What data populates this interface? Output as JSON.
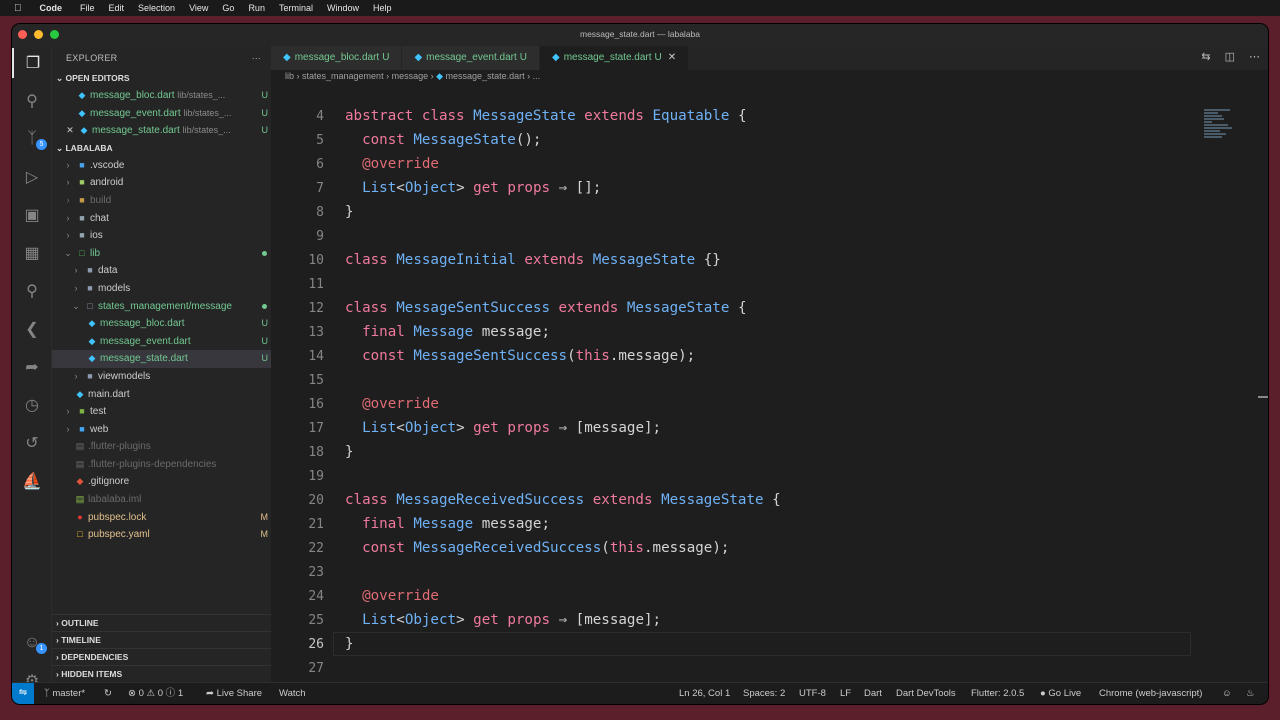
{
  "menubar": {
    "items": [
      "Code",
      "File",
      "Edit",
      "Selection",
      "View",
      "Go",
      "Run",
      "Terminal",
      "Window",
      "Help"
    ]
  },
  "window": {
    "title": "message_state.dart — labalaba"
  },
  "activity": {
    "scm_badge": "5",
    "account_badge": "1"
  },
  "sidebar": {
    "title": "EXPLORER",
    "open_editors_label": "OPEN EDITORS",
    "open_editors": [
      {
        "name": "message_bloc.dart",
        "path": "lib/states_...",
        "status": "U"
      },
      {
        "name": "message_event.dart",
        "path": "lib/states_...",
        "status": "U"
      },
      {
        "name": "message_state.dart",
        "path": "lib/states_...",
        "status": "U"
      }
    ],
    "workspace_label": "LABALABA",
    "tree": [
      {
        "name": ".vscode",
        "status": ""
      },
      {
        "name": "android",
        "status": ""
      },
      {
        "name": "build",
        "status": ""
      },
      {
        "name": "chat",
        "status": ""
      },
      {
        "name": "ios",
        "status": ""
      },
      {
        "name": "lib",
        "status": ""
      },
      {
        "name": "data",
        "status": ""
      },
      {
        "name": "models",
        "status": ""
      },
      {
        "name": "states_management/message",
        "status": ""
      },
      {
        "name": "message_bloc.dart",
        "status": "U"
      },
      {
        "name": "message_event.dart",
        "status": "U"
      },
      {
        "name": "message_state.dart",
        "status": "U"
      },
      {
        "name": "viewmodels",
        "status": ""
      },
      {
        "name": "main.dart",
        "status": ""
      },
      {
        "name": "test",
        "status": ""
      },
      {
        "name": "web",
        "status": ""
      },
      {
        "name": ".flutter-plugins",
        "status": ""
      },
      {
        "name": ".flutter-plugins-dependencies",
        "status": ""
      },
      {
        "name": ".gitignore",
        "status": ""
      },
      {
        "name": "labalaba.iml",
        "status": ""
      },
      {
        "name": "pubspec.lock",
        "status": "M"
      },
      {
        "name": "pubspec.yaml",
        "status": "M"
      }
    ],
    "sections": [
      "OUTLINE",
      "TIMELINE",
      "DEPENDENCIES",
      "HIDDEN ITEMS"
    ]
  },
  "tabs": [
    {
      "label": "message_bloc.dart",
      "status": "U"
    },
    {
      "label": "message_event.dart",
      "status": "U"
    },
    {
      "label": "message_state.dart",
      "status": "U"
    }
  ],
  "breadcrumb": [
    "lib",
    "states_management",
    "message",
    "message_state.dart",
    "..."
  ],
  "code_lines": [
    {
      "n": "4",
      "tokens": [
        [
          "k",
          "abstract "
        ],
        [
          "k",
          "class "
        ],
        [
          "t",
          "MessageState "
        ],
        [
          "k",
          "extends "
        ],
        [
          "t",
          "Equatable "
        ],
        [
          "p",
          "{"
        ]
      ]
    },
    {
      "n": "5",
      "tokens": [
        [
          "p",
          "  "
        ],
        [
          "k",
          "const "
        ],
        [
          "t",
          "MessageState"
        ],
        [
          "p",
          "();"
        ]
      ]
    },
    {
      "n": "6",
      "tokens": [
        [
          "p",
          "  "
        ],
        [
          "dec",
          "@override"
        ]
      ]
    },
    {
      "n": "7",
      "tokens": [
        [
          "p",
          "  "
        ],
        [
          "t",
          "List"
        ],
        [
          "p",
          "<"
        ],
        [
          "t",
          "Object"
        ],
        [
          "p",
          "> "
        ],
        [
          "k",
          "get "
        ],
        [
          "k",
          "props "
        ],
        [
          "p",
          "⇒ [];"
        ]
      ]
    },
    {
      "n": "8",
      "tokens": [
        [
          "p",
          "}"
        ]
      ]
    },
    {
      "n": "9",
      "tokens": []
    },
    {
      "n": "10",
      "tokens": [
        [
          "k",
          "class "
        ],
        [
          "t",
          "MessageInitial "
        ],
        [
          "k",
          "extends "
        ],
        [
          "t",
          "MessageState "
        ],
        [
          "p",
          "{}"
        ]
      ]
    },
    {
      "n": "11",
      "tokens": []
    },
    {
      "n": "12",
      "tokens": [
        [
          "k",
          "class "
        ],
        [
          "t",
          "MessageSentSuccess "
        ],
        [
          "k",
          "extends "
        ],
        [
          "t",
          "MessageState "
        ],
        [
          "p",
          "{"
        ]
      ]
    },
    {
      "n": "13",
      "tokens": [
        [
          "p",
          "  "
        ],
        [
          "k",
          "final "
        ],
        [
          "t",
          "Message "
        ],
        [
          "p",
          "message;"
        ]
      ]
    },
    {
      "n": "14",
      "tokens": [
        [
          "p",
          "  "
        ],
        [
          "k",
          "const "
        ],
        [
          "t",
          "MessageSentSuccess"
        ],
        [
          "p",
          "("
        ],
        [
          "k",
          "this"
        ],
        [
          "p",
          ".message);"
        ]
      ]
    },
    {
      "n": "15",
      "tokens": []
    },
    {
      "n": "16",
      "tokens": [
        [
          "p",
          "  "
        ],
        [
          "dec",
          "@override"
        ]
      ]
    },
    {
      "n": "17",
      "tokens": [
        [
          "p",
          "  "
        ],
        [
          "t",
          "List"
        ],
        [
          "p",
          "<"
        ],
        [
          "t",
          "Object"
        ],
        [
          "p",
          "> "
        ],
        [
          "k",
          "get "
        ],
        [
          "k",
          "props "
        ],
        [
          "p",
          "⇒ [message];"
        ]
      ]
    },
    {
      "n": "18",
      "tokens": [
        [
          "p",
          "}"
        ]
      ]
    },
    {
      "n": "19",
      "tokens": []
    },
    {
      "n": "20",
      "tokens": [
        [
          "k",
          "class "
        ],
        [
          "t",
          "MessageReceivedSuccess "
        ],
        [
          "k",
          "extends "
        ],
        [
          "t",
          "MessageState "
        ],
        [
          "p",
          "{"
        ]
      ]
    },
    {
      "n": "21",
      "tokens": [
        [
          "p",
          "  "
        ],
        [
          "k",
          "final "
        ],
        [
          "t",
          "Message "
        ],
        [
          "p",
          "message;"
        ]
      ]
    },
    {
      "n": "22",
      "tokens": [
        [
          "p",
          "  "
        ],
        [
          "k",
          "const "
        ],
        [
          "t",
          "MessageReceivedSuccess"
        ],
        [
          "p",
          "("
        ],
        [
          "k",
          "this"
        ],
        [
          "p",
          ".message);"
        ]
      ]
    },
    {
      "n": "23",
      "tokens": []
    },
    {
      "n": "24",
      "tokens": [
        [
          "p",
          "  "
        ],
        [
          "dec",
          "@override"
        ]
      ]
    },
    {
      "n": "25",
      "tokens": [
        [
          "p",
          "  "
        ],
        [
          "t",
          "List"
        ],
        [
          "p",
          "<"
        ],
        [
          "t",
          "Object"
        ],
        [
          "p",
          "> "
        ],
        [
          "k",
          "get "
        ],
        [
          "k",
          "props "
        ],
        [
          "p",
          "⇒ [message];"
        ]
      ]
    },
    {
      "n": "26",
      "tokens": [
        [
          "p",
          "}"
        ]
      ]
    },
    {
      "n": "27",
      "tokens": []
    }
  ],
  "current_line": "26",
  "status": {
    "branch": "master*",
    "problems": "0",
    "warnings": "0",
    "info": "1",
    "live_share": "Live Share",
    "watch": "Watch",
    "cursor": "Ln 26, Col 1",
    "spaces": "Spaces: 2",
    "encoding": "UTF-8",
    "eol": "LF",
    "language": "Dart",
    "devtools": "Dart DevTools",
    "flutter": "Flutter: 2.0.5",
    "golive": "Go Live",
    "device": "Chrome (web-javascript)"
  }
}
